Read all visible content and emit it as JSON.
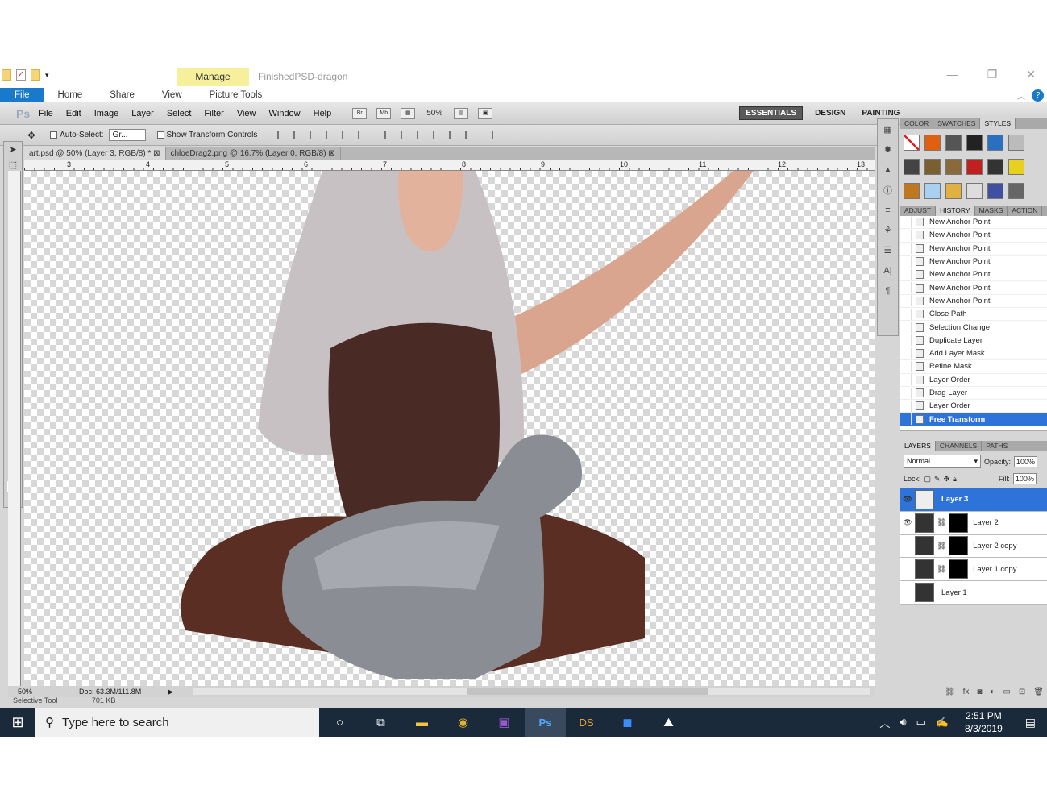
{
  "explorer": {
    "manage_label": "Manage",
    "window_title": "FinishedPSD-dragon",
    "tabs": [
      "File",
      "Home",
      "Share",
      "View",
      "Picture Tools"
    ],
    "minimize": "—",
    "maximize": "❐",
    "close": "✕",
    "help": "?"
  },
  "ps": {
    "logo": "Ps",
    "menus": [
      "File",
      "Edit",
      "Image",
      "Layer",
      "Select",
      "Filter",
      "View",
      "Window",
      "Help"
    ],
    "zoom": "50%",
    "workspaces": {
      "essentials": "ESSENTIALS",
      "design": "DESIGN",
      "painting": "PAINTING"
    },
    "options": {
      "auto_select_label": "Auto-Select:",
      "auto_select_value": "Gr...",
      "show_transform_label": "Show Transform Controls"
    },
    "doc_tabs": [
      "art.psd @ 50% (Layer 3, RGB/8) *",
      "chloeDrag2.png @ 16.7% (Layer 0, RGB/8)"
    ],
    "ruler_nums": [
      "3",
      "4",
      "5",
      "6",
      "7",
      "8",
      "9",
      "10",
      "11",
      "12",
      "13"
    ],
    "status": {
      "zoom": "50%",
      "doc": "Doc: 63.3M/111.8M",
      "tool": "Selective Tool",
      "size": "701 KB"
    }
  },
  "panels": {
    "top_tabs": [
      "COLOR",
      "SWATCHES",
      "STYLES"
    ],
    "mid_tabs": [
      "ADJUST",
      "HISTORY",
      "MASKS",
      "ACTION"
    ],
    "history": [
      "New Anchor Point",
      "New Anchor Point",
      "New Anchor Point",
      "New Anchor Point",
      "New Anchor Point",
      "New Anchor Point",
      "New Anchor Point",
      "Close Path",
      "Selection Change",
      "Duplicate Layer",
      "Add Layer Mask",
      "Refine Mask",
      "Layer Order",
      "Drag Layer",
      "Layer Order",
      "Free Transform"
    ],
    "layer_tabs": [
      "LAYERS",
      "CHANNELS",
      "PATHS"
    ],
    "blend_mode": "Normal",
    "opacity_label": "Opacity:",
    "opacity": "100%",
    "lock_label": "Lock:",
    "fill_label": "Fill:",
    "fill": "100%",
    "layers": [
      "Layer 3",
      "Layer 2",
      "Layer 2 copy",
      "Layer 1 copy",
      "Layer 1"
    ]
  },
  "taskbar": {
    "search_placeholder": "Type here to search",
    "time": "2:51 PM",
    "date": "8/3/2019"
  }
}
